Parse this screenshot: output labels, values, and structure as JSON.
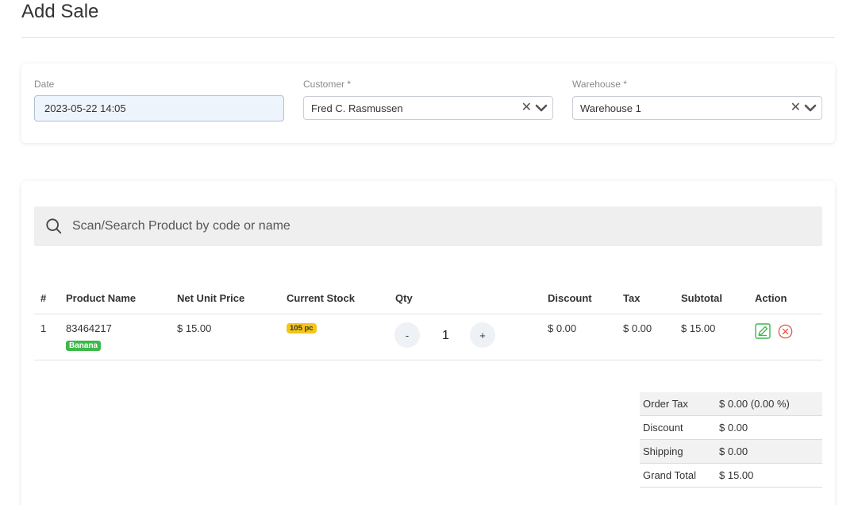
{
  "page": {
    "title": "Add Sale"
  },
  "form": {
    "date_label": "Date",
    "date_value": "2023-05-22 14:05",
    "customer_label": "Customer *",
    "customer_value": "Fred C. Rasmussen",
    "warehouse_label": "Warehouse *",
    "warehouse_value": "Warehouse 1"
  },
  "search": {
    "placeholder": "Scan/Search Product by code or name"
  },
  "table": {
    "headers": {
      "num": "#",
      "product": "Product Name",
      "net_price": "Net Unit Price",
      "stock": "Current Stock",
      "qty": "Qty",
      "discount": "Discount",
      "tax": "Tax",
      "subtotal": "Subtotal",
      "action": "Action"
    },
    "rows": [
      {
        "num": "1",
        "code": "83464217",
        "name": "Banana",
        "net_price": "$ 15.00",
        "stock": "105 pc",
        "qty_minus": "-",
        "qty": "1",
        "qty_plus": "+",
        "discount": "$ 0.00",
        "tax": "$ 0.00",
        "subtotal": "$ 15.00"
      }
    ]
  },
  "summary": {
    "order_tax_label": "Order Tax",
    "order_tax_value": "$ 0.00 (0.00 %)",
    "discount_label": "Discount",
    "discount_value": "$ 0.00",
    "shipping_label": "Shipping",
    "shipping_value": "$ 0.00",
    "grand_total_label": "Grand Total",
    "grand_total_value": "$ 15.00"
  },
  "colors": {
    "badge_product": "#3db84a",
    "badge_stock": "#f5c518",
    "edit_icon": "#3db84a",
    "delete_icon": "#e74c3c"
  },
  "icons": {
    "search": "search-icon",
    "clear": "close-icon",
    "dropdown": "chevron-down-icon",
    "edit": "edit-icon",
    "delete": "delete-icon"
  }
}
